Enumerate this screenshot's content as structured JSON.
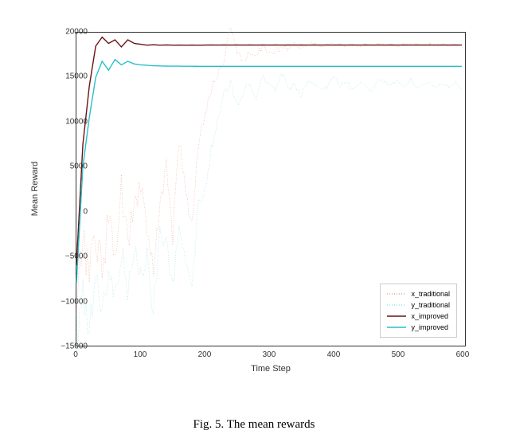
{
  "caption": "Fig. 5. The mean rewards",
  "chart_data": {
    "type": "line",
    "title": "",
    "xlabel": "Time Step",
    "ylabel": "Mean Reward",
    "xlim": [
      0,
      600
    ],
    "ylim": [
      -15000,
      20000
    ],
    "xticks": [
      0,
      100,
      200,
      300,
      400,
      500,
      600
    ],
    "yticks": [
      -15000,
      -10000,
      -5000,
      0,
      5000,
      10000,
      15000,
      20000
    ],
    "x": [
      0,
      10,
      20,
      30,
      40,
      50,
      60,
      70,
      80,
      90,
      100,
      110,
      120,
      130,
      140,
      150,
      160,
      170,
      180,
      190,
      200,
      210,
      220,
      230,
      240,
      250,
      260,
      270,
      280,
      290,
      300,
      310,
      320,
      330,
      340,
      350,
      360,
      370,
      380,
      390,
      400,
      410,
      420,
      430,
      440,
      450,
      460,
      470,
      480,
      490,
      500,
      510,
      520,
      530,
      540,
      550,
      560,
      570,
      580,
      590,
      600
    ],
    "series": [
      {
        "name": "x_traditional",
        "style": "dotted",
        "color": "#e37a5a",
        "values": [
          -8000,
          -4000,
          -6500,
          -2000,
          -7000,
          -500,
          -5500,
          2500,
          -4000,
          1000,
          3000,
          -2000,
          -6500,
          500,
          5000,
          -3000,
          8000,
          2000,
          -1000,
          8000,
          11000,
          14000,
          15500,
          17000,
          20500,
          18000,
          16500,
          18000,
          17500,
          18500,
          17800,
          18000,
          18500,
          18200,
          18800,
          18400,
          18600,
          18800,
          18500,
          18700,
          18600,
          18700,
          18600,
          18800,
          18600,
          18700,
          18600,
          18700,
          18600,
          18700,
          18600,
          18700,
          18600,
          18700,
          18600,
          18700,
          18600,
          18700,
          18600,
          18700,
          18600
        ]
      },
      {
        "name": "y_traditional",
        "style": "dotted",
        "color": "#6ad1d6",
        "values": [
          -14000,
          -10000,
          -12500,
          -8000,
          -11000,
          -6000,
          -9500,
          -4000,
          -10000,
          -3000,
          -7000,
          -5000,
          -11000,
          -2500,
          -4000,
          -8000,
          -2000,
          -5500,
          -9000,
          1000,
          2000,
          7000,
          10000,
          13000,
          14500,
          12000,
          13500,
          14000,
          13000,
          15000,
          14500,
          13500,
          15500,
          13800,
          14200,
          12800,
          14800,
          14200,
          13600,
          13800,
          15200,
          14000,
          14600,
          13600,
          14400,
          14000,
          13400,
          14800,
          14400,
          14200,
          14600,
          14000,
          14800,
          13800,
          14400,
          14400,
          14000,
          14200,
          13800,
          14600,
          13600
        ]
      },
      {
        "name": "x_improved",
        "style": "solid",
        "color": "#6b1212",
        "values": [
          -6000,
          7500,
          14000,
          18500,
          19500,
          18800,
          19200,
          18400,
          19200,
          18800,
          18700,
          18600,
          18650,
          18600,
          18620,
          18600,
          18610,
          18600,
          18610,
          18600,
          18610,
          18620,
          18610,
          18620,
          18610,
          18620,
          18610,
          18620,
          18610,
          18620,
          18610,
          18620,
          18610,
          18620,
          18610,
          18620,
          18610,
          18620,
          18610,
          18620,
          18610,
          18620,
          18610,
          18620,
          18610,
          18620,
          18610,
          18620,
          18610,
          18620,
          18610,
          18620,
          18610,
          18620,
          18610,
          18620,
          18610,
          18620,
          18610,
          18620,
          18610
        ]
      },
      {
        "name": "y_improved",
        "style": "solid",
        "color": "#27bfca",
        "values": [
          -8000,
          5000,
          10500,
          15000,
          16800,
          15800,
          17000,
          16400,
          16800,
          16500,
          16400,
          16350,
          16300,
          16280,
          16260,
          16250,
          16250,
          16240,
          16240,
          16235,
          16235,
          16230,
          16230,
          16230,
          16230,
          16230,
          16230,
          16230,
          16230,
          16230,
          16230,
          16230,
          16230,
          16230,
          16230,
          16230,
          16230,
          16230,
          16230,
          16230,
          16230,
          16230,
          16230,
          16230,
          16230,
          16230,
          16230,
          16230,
          16230,
          16230,
          16230,
          16230,
          16230,
          16230,
          16230,
          16230,
          16230,
          16230,
          16230,
          16230,
          16230
        ]
      }
    ],
    "legend": {
      "position": "lower right",
      "entries": [
        "x_traditional",
        "y_traditional",
        "x_improved",
        "y_improved"
      ]
    }
  }
}
